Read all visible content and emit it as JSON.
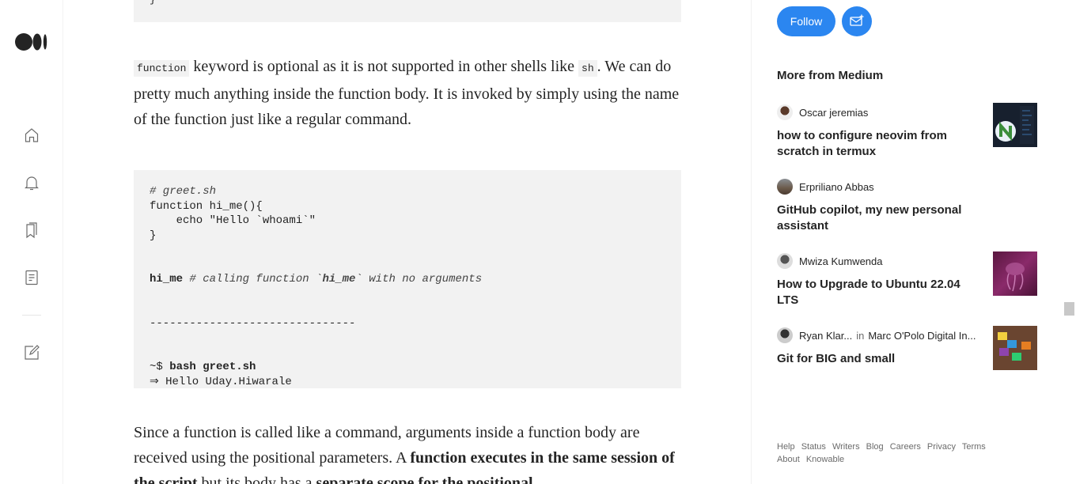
{
  "rail": {
    "icons": [
      "home-icon",
      "bell-icon",
      "bookmarks-icon",
      "stories-icon",
      "write-icon"
    ]
  },
  "article": {
    "code_top_tail": "}",
    "para1": {
      "code1": "function",
      "text1": " keyword is optional as it is not supported in other shells like ",
      "code2": "sh",
      "text2": ". We can do pretty much anything inside the function body. It is invoked by simply using the name of the function just like a regular command."
    },
    "code": {
      "l1_comment": "# greet.sh",
      "l2": "function hi_me(){",
      "l3": "    echo \"Hello `whoami`\"",
      "l4": "}",
      "l5_bold": "hi_me",
      "l5_comment_a": " # calling function `",
      "l5_comment_bold": "hi_me",
      "l5_comment_b": "` with no arguments",
      "l6": "-------------------------------",
      "l7_prompt": "~$ ",
      "l7_cmd": "bash greet.sh",
      "l8": "⇒ Hello Uday.Hiwarale"
    },
    "para2": {
      "text1": "Since a function is called like a command, arguments inside a function body are received using the positional parameters. A ",
      "bold1": "function executes in the same session of the script",
      "text2": " but its body has a ",
      "bold2": "separate scope for the positional"
    }
  },
  "sidebar": {
    "follow_label": "Follow",
    "more_heading": "More from Medium",
    "stories": [
      {
        "author": "Oscar jeremias",
        "publication": "",
        "title": "how to configure neovim from scratch in termux"
      },
      {
        "author": "Erpriliano Abbas",
        "publication": "",
        "title": "GitHub copilot, my new personal assistant"
      },
      {
        "author": "Mwiza Kumwenda",
        "publication": "",
        "title": "How to Upgrade to Ubuntu 22.04 LTS"
      },
      {
        "author": "Ryan Klar...",
        "in_word": "in",
        "publication": "Marc O'Polo Digital In...",
        "title": "Git for BIG and small"
      }
    ],
    "footer_links": [
      "Help",
      "Status",
      "Writers",
      "Blog",
      "Careers",
      "Privacy",
      "Terms",
      "About",
      "Knowable"
    ]
  },
  "colors": {
    "accent": "#2b86f0",
    "code_bg": "#f2f2f2",
    "text": "#242424",
    "muted": "#6b6b6b"
  }
}
